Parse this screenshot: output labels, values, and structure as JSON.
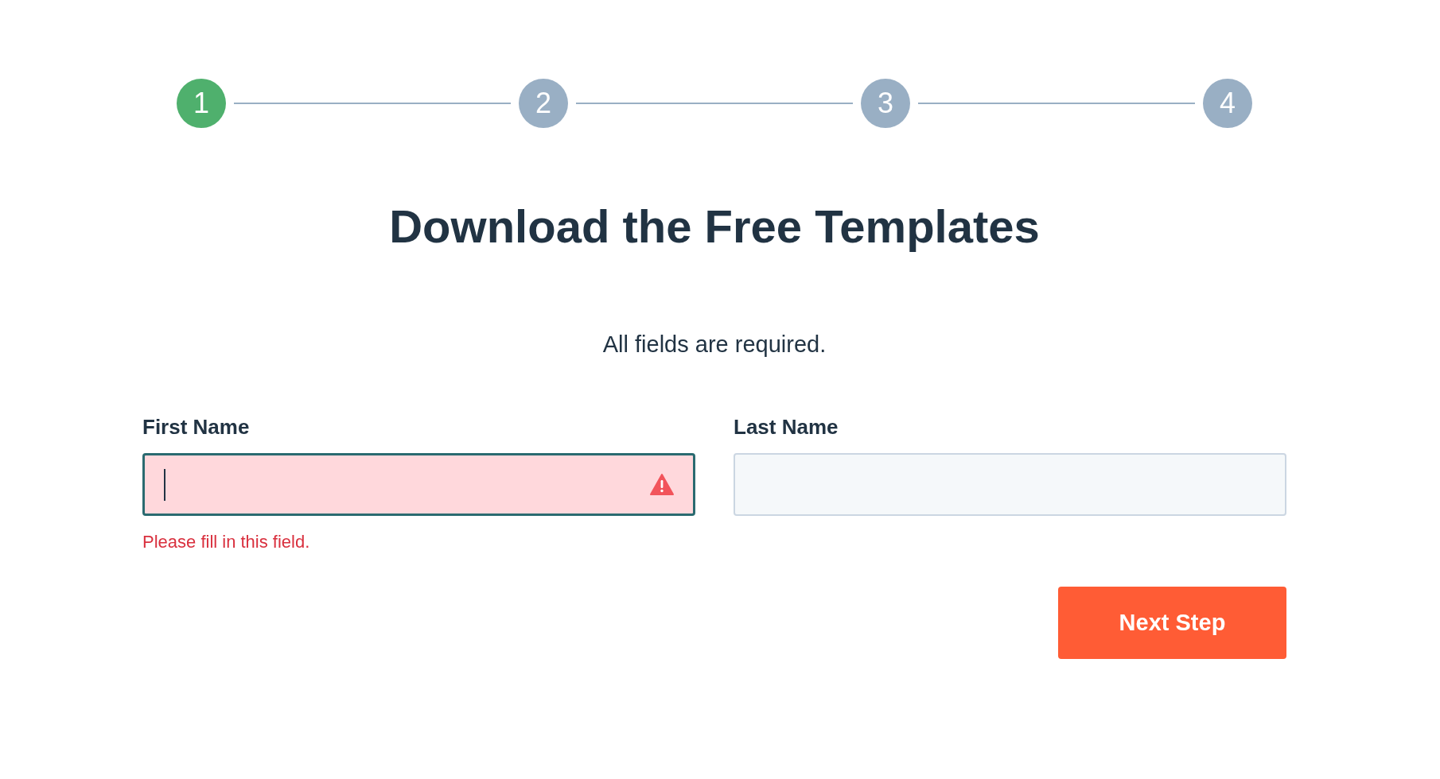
{
  "steps": [
    {
      "label": "1",
      "selected": true
    },
    {
      "label": "2",
      "selected": false
    },
    {
      "label": "3",
      "selected": false
    },
    {
      "label": "4",
      "selected": false
    }
  ],
  "heading": "Download the Free Templates",
  "note": "All fields are required.",
  "fields": [
    {
      "label": "First Name",
      "focused": true,
      "invalid": true,
      "error": "Please fill in this field."
    },
    {
      "label": "Last Name",
      "focused": false,
      "invalid": false
    }
  ],
  "button": "Next Step"
}
